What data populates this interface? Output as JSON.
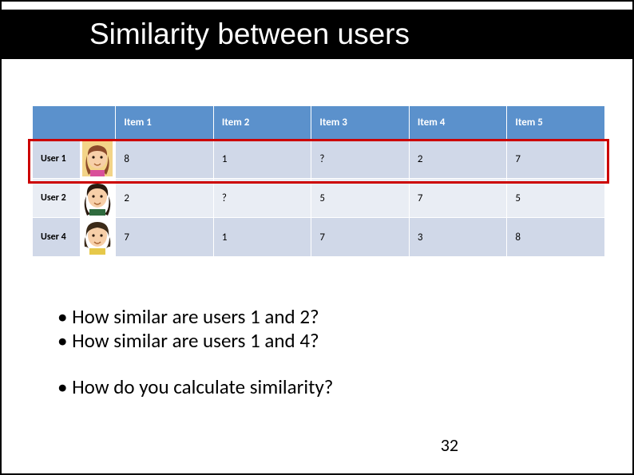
{
  "title": "Similarity between users",
  "columns": [
    "Item 1",
    "Item 2",
    "Item 3",
    "Item 4",
    "Item 5"
  ],
  "rows": [
    {
      "label": "User 1",
      "values": [
        "8",
        "1",
        "?",
        "2",
        "7"
      ]
    },
    {
      "label": "User 2",
      "values": [
        "2",
        "?",
        "5",
        "7",
        "5"
      ]
    },
    {
      "label": "User 4",
      "values": [
        "7",
        "1",
        "7",
        "3",
        "8"
      ]
    }
  ],
  "bullets": {
    "q1": "• How similar are users 1 and 2?",
    "q2": "• How similar are users 1 and 4?",
    "q3": "• How do you calculate similarity?"
  },
  "page_number": "32",
  "avatars": {
    "hair0": "#8b4a2a",
    "hair1": "#2a1a0e",
    "hair2": "#3b2a18"
  }
}
